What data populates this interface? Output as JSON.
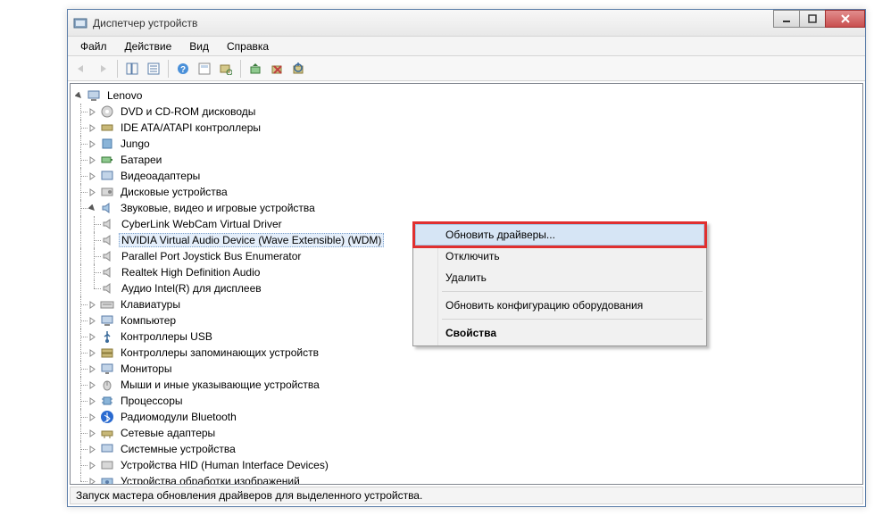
{
  "title": "Диспетчер устройств",
  "menus": {
    "file": "Файл",
    "action": "Действие",
    "view": "Вид",
    "help": "Справка"
  },
  "root": "Lenovo",
  "categories": {
    "dvd": "DVD и CD-ROM дисководы",
    "ide": "IDE ATA/ATAPI контроллеры",
    "jungo": "Jungo",
    "batteries": "Батареи",
    "video": "Видеоадаптеры",
    "disk": "Дисковые устройства",
    "sound": "Звуковые, видео и игровые устройства",
    "keyboards": "Клавиатуры",
    "computer": "Компьютер",
    "usb": "Контроллеры USB",
    "storage": "Контроллеры запоминающих устройств",
    "monitors": "Мониторы",
    "mice": "Мыши и иные указывающие устройства",
    "cpu": "Процессоры",
    "bt": "Радиомодули Bluetooth",
    "net": "Сетевые адаптеры",
    "system": "Системные устройства",
    "hid": "Устройства HID (Human Interface Devices)",
    "imaging": "Устройства обработки изображений"
  },
  "sound_children": {
    "c0": "CyberLink WebCam Virtual Driver",
    "c1": "NVIDIA Virtual Audio Device (Wave Extensible) (WDM)",
    "c2": "Parallel Port Joystick Bus Enumerator",
    "c3": "Realtek High Definition Audio",
    "c4": "Аудио Intel(R) для дисплеев"
  },
  "context_menu": {
    "update": "Обновить драйверы...",
    "disable": "Отключить",
    "delete": "Удалить",
    "scan": "Обновить конфигурацию оборудования",
    "props": "Свойства"
  },
  "status": "Запуск мастера обновления драйверов для выделенного устройства."
}
